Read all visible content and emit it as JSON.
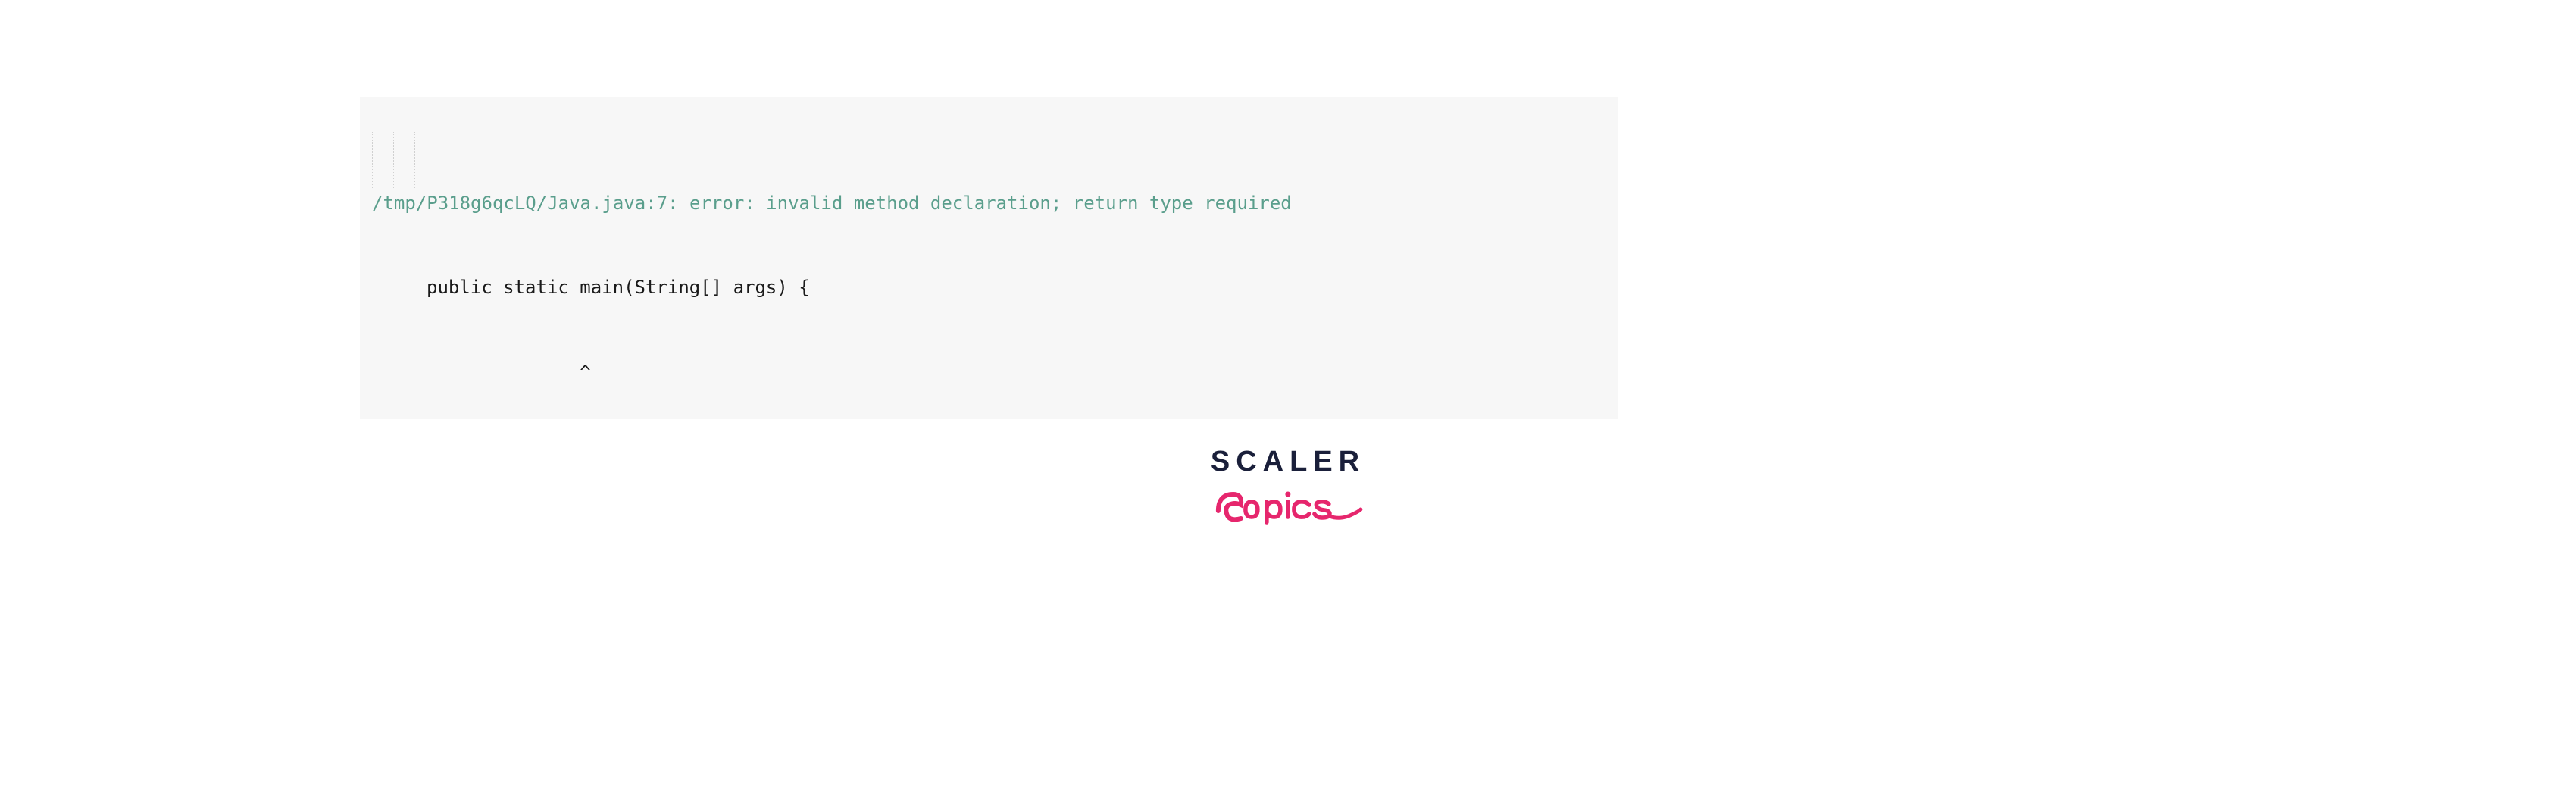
{
  "error": {
    "path": "/tmp/P318g6qcLQ/Java.java:7: error: invalid method declaration; return type required",
    "code_line": "public static main(String[] args) {",
    "caret": "              ^"
  },
  "logo": {
    "primary": "SCALER",
    "secondary": "Topics"
  },
  "colors": {
    "error_text": "#5a9e8c",
    "code_text": "#1a1a1a",
    "code_bg": "#f7f7f7",
    "logo_primary": "#1a1f3a",
    "logo_secondary": "#e6266d"
  }
}
